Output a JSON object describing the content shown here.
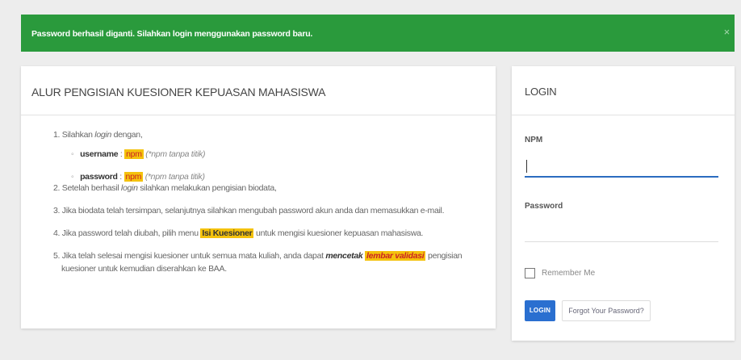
{
  "alert": {
    "message": "Password berhasil diganti. Silahkan login menggunakan password baru.",
    "close_label": "×"
  },
  "alur": {
    "title": "ALUR PENGISIAN KUESIONER KEPUASAN MAHASISWA",
    "step1": {
      "num": "1.",
      "pre": "Silahkan ",
      "login_word": "login",
      "post": " dengan,"
    },
    "username": {
      "key": "username",
      "sep": " : ",
      "value": "npm",
      "note": " (*npm tanpa titik)"
    },
    "password": {
      "key": "password",
      "sep": " : ",
      "value": "npm",
      "note": " (*npm tanpa titik)"
    },
    "step2": {
      "num": "2.",
      "pre": "Setelah berhasil ",
      "login_word": "login",
      "post": " silahkan melakukan pengisian biodata,"
    },
    "step3": {
      "num": "3.",
      "text": "Jika biodata telah tersimpan, selanjutnya silahkan mengubah password akun anda dan memasukkan e-mail."
    },
    "step4": {
      "num": "4.",
      "pre": "Jika password telah diubah, pilih menu ",
      "menu": "Isi Kuesioner",
      "post": " untuk mengisi kuesioner kepuasan mahasiswa."
    },
    "step5": {
      "num": "5.",
      "pre": "Jika telah selesai mengisi kuesioner untuk semua mata kuliah, anda dapat ",
      "em": "mencetak",
      "space": " ",
      "hl": "lembar validasi",
      "post": " pengisian",
      "line2": "kuesioner untuk kemudian diserahkan ke BAA."
    }
  },
  "login": {
    "title": "LOGIN",
    "npm_label": "NPM",
    "npm_value": "",
    "password_label": "Password",
    "password_value": "",
    "remember_label": "Remember Me",
    "login_button": "LOGIN",
    "forgot_button": "Forgot Your Password?"
  },
  "colors": {
    "alert_bg": "#2a9a3c",
    "primary": "#2a6fd0",
    "highlight": "#f4c20d"
  }
}
